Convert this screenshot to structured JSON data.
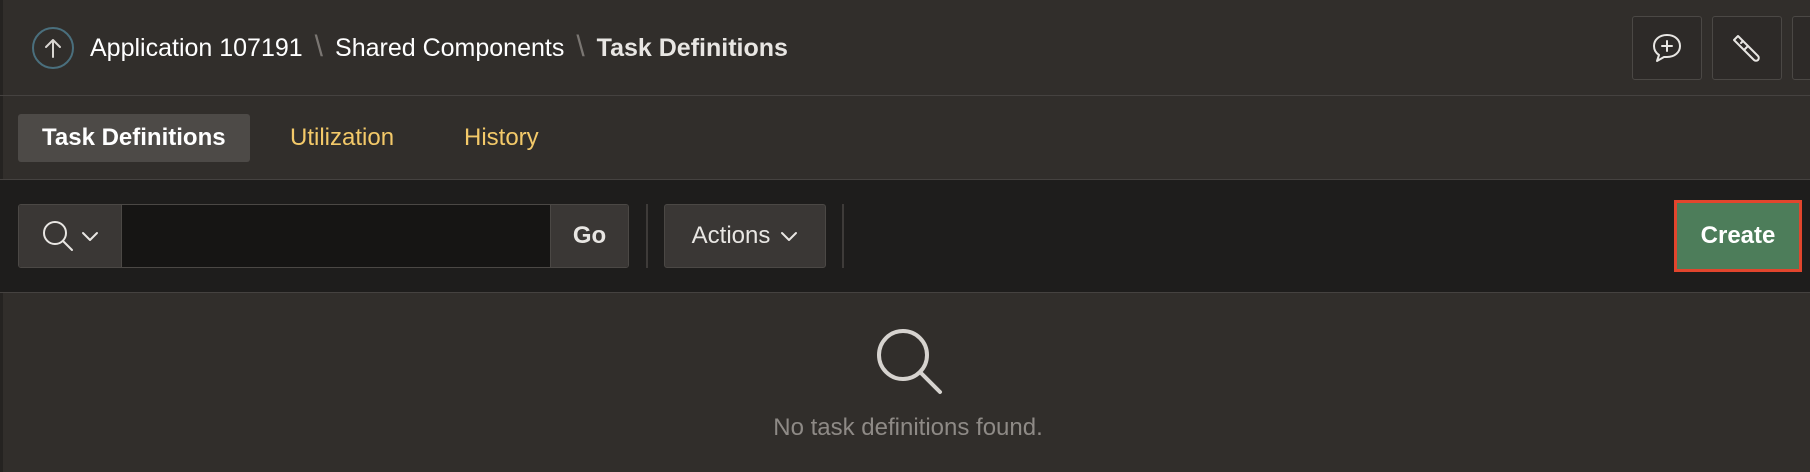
{
  "breadcrumb": {
    "items": [
      "Application 107191",
      "Shared Components",
      "Task Definitions"
    ],
    "separator": "\\"
  },
  "header_actions": [
    {
      "icon": "comment-plus-icon"
    },
    {
      "icon": "flashlight-icon"
    }
  ],
  "tabs": [
    {
      "label": "Task Definitions",
      "active": true
    },
    {
      "label": "Utilization",
      "active": false
    },
    {
      "label": "History",
      "active": false
    }
  ],
  "toolbar": {
    "search_value": "",
    "go_label": "Go",
    "actions_label": "Actions",
    "create_label": "Create"
  },
  "empty_state": {
    "icon": "search-icon",
    "message": "No task definitions found."
  },
  "colors": {
    "background": "#312e2b",
    "toolbar_background": "#1e1d1c",
    "tab_link": "#f3c969",
    "create_button": "#4d7d5a",
    "create_highlight": "#e2452d"
  }
}
